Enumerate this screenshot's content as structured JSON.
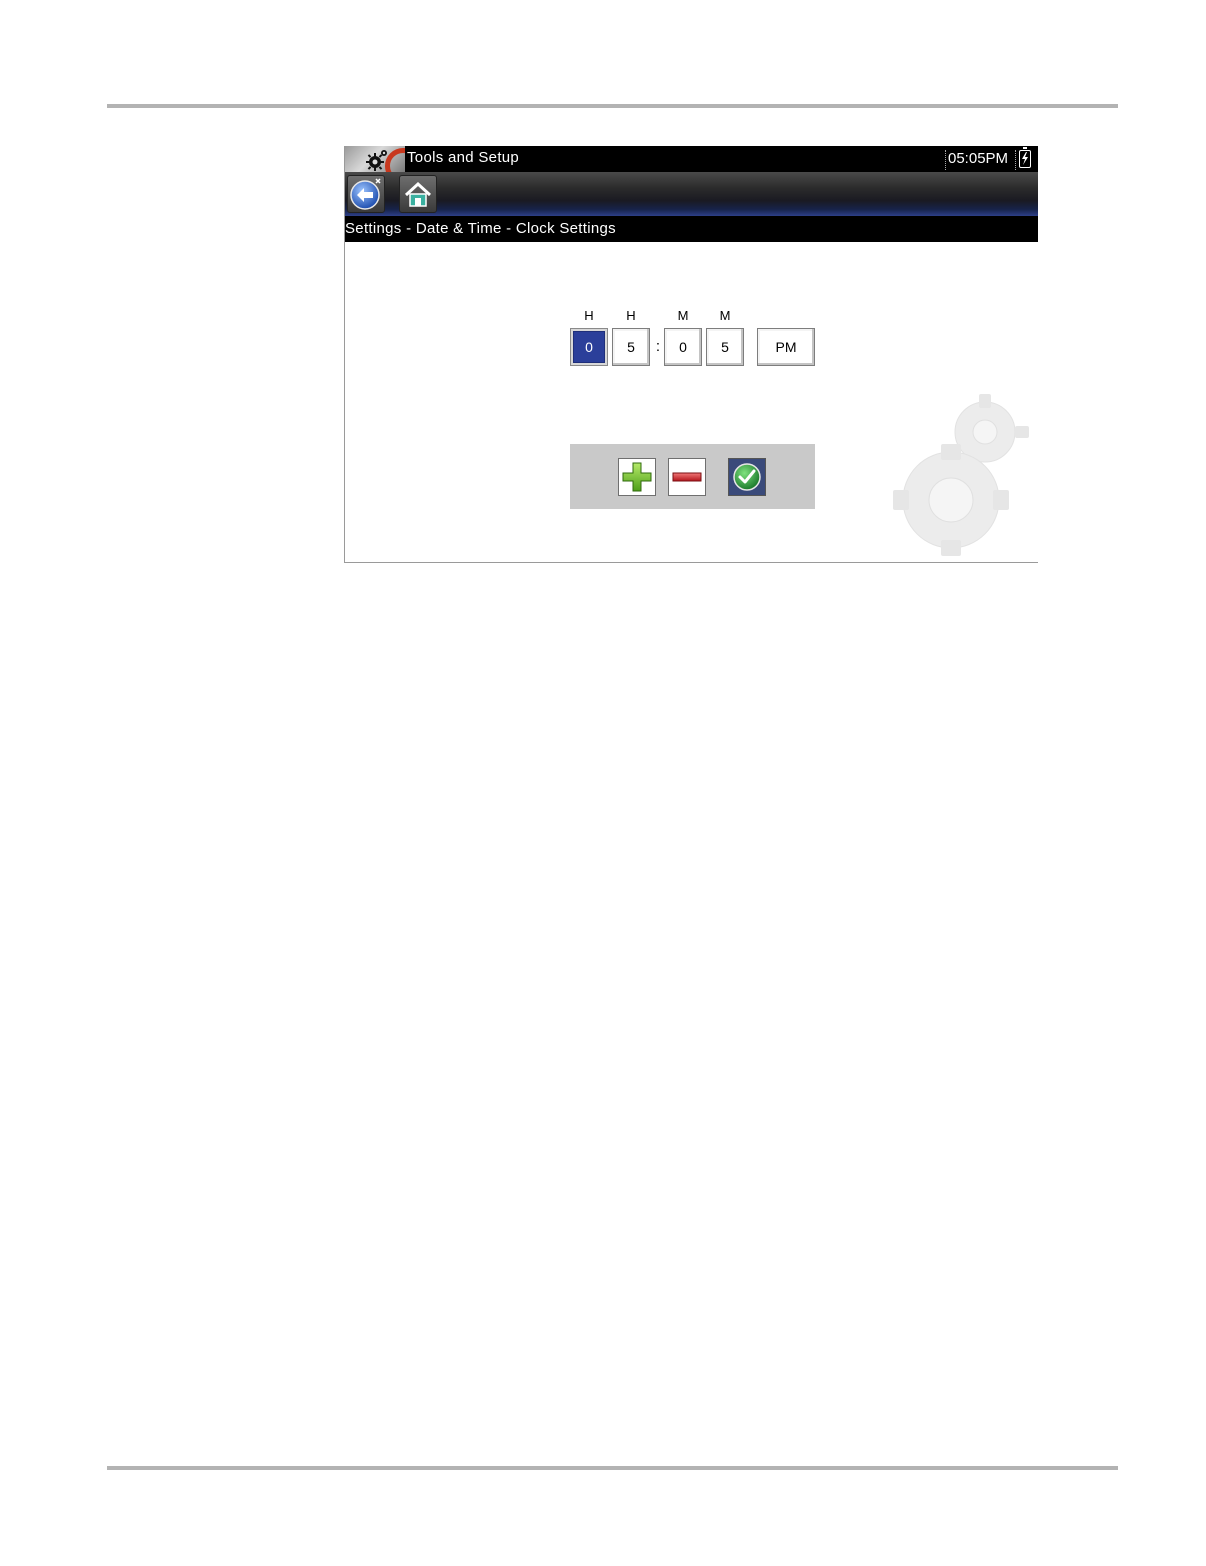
{
  "titlebar": {
    "title": "Tools and Setup",
    "clock": "05:05PM"
  },
  "breadcrumb": "Settings - Date & Time - Clock Settings",
  "time_editor": {
    "labels": [
      "H",
      "H",
      "M",
      "M"
    ],
    "digits": [
      "0",
      "5",
      "0",
      "5"
    ],
    "separator": ":",
    "meridiem": "PM",
    "selected_index": 0
  },
  "colors": {
    "selected_digit": "#2b3f9a",
    "plus_green": "#6fbf2a",
    "minus_red": "#d0262b",
    "confirm_green": "#2ea043",
    "panel_gray": "#c9c9c9"
  },
  "icons": {
    "app": "tools-gear-icon",
    "back": "back-arrow-icon",
    "home": "home-icon",
    "battery": "battery-icon",
    "plus": "plus-icon",
    "minus": "minus-icon",
    "confirm": "checkmark-icon"
  }
}
